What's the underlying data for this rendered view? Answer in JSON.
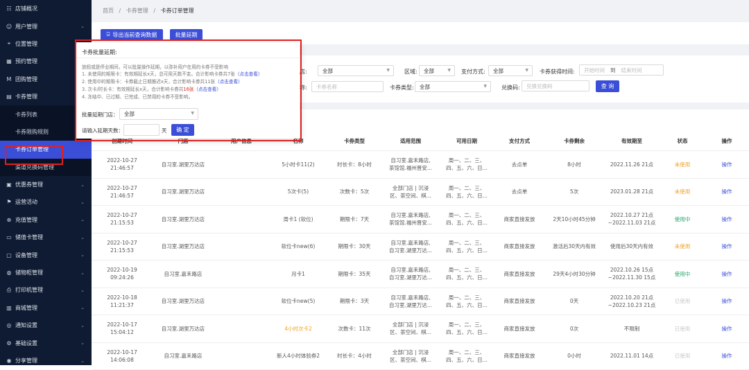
{
  "sidebar": {
    "items": [
      {
        "label": "店铺概况",
        "icon": "grid-icon",
        "glyph": "☷",
        "chev": false
      },
      {
        "label": "用户管理",
        "icon": "user-icon",
        "glyph": "☺",
        "chev": true
      },
      {
        "label": "位置管理",
        "icon": "location-icon",
        "glyph": "⌖",
        "chev": true
      },
      {
        "label": "预约管理",
        "icon": "calendar-icon",
        "glyph": "▦",
        "chev": true
      },
      {
        "label": "团购管理",
        "icon": "group-buy-icon",
        "glyph": "M",
        "chev": true
      },
      {
        "label": "卡券管理",
        "icon": "card-icon",
        "glyph": "▤",
        "chev": true,
        "open": true
      },
      {
        "label": "卡券列表",
        "sub": true
      },
      {
        "label": "卡券限购规则",
        "sub": true
      },
      {
        "label": "卡券订单管理",
        "sub": true,
        "active": true
      },
      {
        "label": "渠道兑换码管理",
        "sub": true
      },
      {
        "label": "优惠券管理",
        "icon": "coupon-icon",
        "glyph": "▣",
        "chev": true
      },
      {
        "label": "运营活动",
        "icon": "activity-icon",
        "glyph": "⚑",
        "chev": true
      },
      {
        "label": "充值管理",
        "icon": "recharge-icon",
        "glyph": "⊕",
        "chev": true
      },
      {
        "label": "储值卡管理",
        "icon": "stored-card-icon",
        "glyph": "▭",
        "chev": true
      },
      {
        "label": "设备管理",
        "icon": "device-icon",
        "glyph": "▢",
        "chev": true
      },
      {
        "label": "储物柜管理",
        "icon": "locker-icon",
        "glyph": "◍",
        "chev": true
      },
      {
        "label": "打印机管理",
        "icon": "printer-icon",
        "glyph": "⎙",
        "chev": true
      },
      {
        "label": "商城管理",
        "icon": "shop-icon",
        "glyph": "▥",
        "chev": true
      },
      {
        "label": "通知设置",
        "icon": "bell-icon",
        "glyph": "◎",
        "chev": true
      },
      {
        "label": "基础设置",
        "icon": "gear-icon",
        "glyph": "⚙",
        "chev": true
      },
      {
        "label": "分享管理",
        "icon": "share-icon",
        "glyph": "◉",
        "chev": true
      }
    ]
  },
  "breadcrumb": {
    "home": "首页",
    "sep": "/",
    "level1": "卡券管理",
    "current": "卡券订单管理"
  },
  "toolbar": {
    "export_icon": "export-icon",
    "export_glyph": "⍈",
    "export_label": "导出当前查询数据",
    "batch_label": "批量延期"
  },
  "filters": {
    "store_label": "门店:",
    "store_value": "全部",
    "region_label": "区域:",
    "region_value": "全部",
    "pay_label": "支付方式:",
    "pay_value": "全部",
    "time_label": "卡券获得时间:",
    "start_placeholder": "开始时间",
    "to": "到",
    "end_placeholder": "结束时间",
    "name_label": "名称:",
    "name_placeholder": "卡券名称",
    "type_label": "卡券类型:",
    "type_value": "全部",
    "code_label": "兑换码:",
    "code_placeholder": "兑换兑换码",
    "query_label": "查 询"
  },
  "table": {
    "columns": [
      "创建时间",
      "门店",
      "用户信息",
      "名称",
      "卡券类型",
      "适用范围",
      "可用日期",
      "支付方式",
      "卡券剩余",
      "有效期至",
      "状态",
      "操作"
    ],
    "rows": [
      {
        "time": [
          "2022-10-27",
          "21:46:57"
        ],
        "store": "自习室.湖里万达店",
        "user": "",
        "name": "5小时卡11(2)",
        "type": "时长卡：8小时",
        "scope": [
          "自习室.嘉禾路店,",
          "茶馆馆.福州晋安..."
        ],
        "date": [
          "周一、二、三、",
          "四、五、六、日..."
        ],
        "pay": "去点单",
        "remain": "8小时",
        "expire": [
          "2022.11.26 21点"
        ],
        "status": "未使用",
        "status_class": "st-unused",
        "op": "操作"
      },
      {
        "time": [
          "2022-10-27",
          "21:46:57"
        ],
        "store": "自习室.湖里万达店",
        "user": "",
        "name": "5次卡(5)",
        "type": "次数卡：5次",
        "scope": [
          "全部门店 | 沉浸",
          "区、茶空间、棋..."
        ],
        "date": [
          "周一、二、三、",
          "四、五、六、日..."
        ],
        "pay": "去点单",
        "remain": "5次",
        "expire": [
          "2023.01.28 21点"
        ],
        "status": "未使用",
        "status_class": "st-unused",
        "op": "操作"
      },
      {
        "time": [
          "2022-10-27",
          "21:15:53"
        ],
        "store": "自习室.湖里万达店",
        "user": "",
        "name": "周卡1 (软位)",
        "type": "期限卡：7天",
        "scope": [
          "自习室.嘉禾路店,",
          "茶馆馆.福州晋安..."
        ],
        "date": [
          "周一、二、三、",
          "四、五、六、日..."
        ],
        "pay": "商家直接发放",
        "remain": "2天10小时45分钟",
        "expire": [
          "2022.10.27 21点",
          "~2022.11.03 21点"
        ],
        "status": "使用中",
        "status_class": "st-using",
        "op": "操作"
      },
      {
        "time": [
          "2022-10-27",
          "21:15:53"
        ],
        "store": "自习室.湖里万达店",
        "user": "",
        "name": "软位卡new(6)",
        "type": "期限卡：30天",
        "scope": [
          "自习室.嘉禾路店,",
          "自习室.湖里万达..."
        ],
        "date": [
          "周一、二、三、",
          "四、五、六、日..."
        ],
        "pay": "商家直接发放",
        "remain": "激活后30天内有效",
        "expire": [
          "使用后30天内有效"
        ],
        "status": "未使用",
        "status_class": "st-unused",
        "op": "操作"
      },
      {
        "time": [
          "2022-10-19",
          "09:24:26"
        ],
        "store": "自习室.嘉禾路店",
        "user": "",
        "name": "月卡1",
        "type": "期限卡：35天",
        "scope": [
          "自习室.嘉禾路店,",
          "自习室.湖里万达..."
        ],
        "date": [
          "周一、二、三、",
          "四、五、六、日..."
        ],
        "pay": "商家直接发放",
        "remain": "29天4小时30分钟",
        "expire": [
          "2022.10.26 15点",
          "~2022.11.30 15点"
        ],
        "status": "使用中",
        "status_class": "st-using",
        "op": "操作"
      },
      {
        "time": [
          "2022-10-18",
          "11:21:37"
        ],
        "store": "自习室.湖里万达店",
        "user": "",
        "name": "软位卡new(5)",
        "type": "期限卡：3天",
        "scope": [
          "自习室.嘉禾路店,",
          "自习室.湖里万达..."
        ],
        "date": [
          "周一、二、三、",
          "四、五、六、日..."
        ],
        "pay": "商家直接发放",
        "remain": "0天",
        "expire": [
          "2022.10.20 21点",
          "~2022.10.23 21点"
        ],
        "status": "已使用",
        "status_class": "st-used",
        "op": "操作"
      },
      {
        "time": [
          "2022-10-17",
          "15:04:12"
        ],
        "store": "自习室.湖里万达店",
        "user": "",
        "name": "4小时次卡2",
        "type": "次数卡：11次",
        "scope": [
          "全部门店 | 沉浸",
          "区、茶空间、棋..."
        ],
        "date": [
          "周一、二、三、",
          "四、五、六、日..."
        ],
        "pay": "商家直接发放",
        "remain": "0次",
        "expire": [
          "不限制"
        ],
        "status": "已使用",
        "status_class": "st-used",
        "op": "操作"
      },
      {
        "time": [
          "2022-10-17",
          "14:06:08"
        ],
        "store": "自习室.嘉禾路店",
        "user": "",
        "name": "新人4小时体验券2",
        "type": "时长卡：4小时",
        "scope": [
          "全部门店 | 沉浸",
          "区、茶空间、棋..."
        ],
        "date": [
          "周一、二、三、",
          "四、五、六、日..."
        ],
        "pay": "商家直接发放",
        "remain": "0小时",
        "expire": [
          "2022.11.01 14点"
        ],
        "status": "已使用",
        "status_class": "st-used",
        "op": "操作"
      }
    ]
  },
  "popup": {
    "title": "卡券批量延期:",
    "intro": "放假或是停业期间，可以批量操作延期，以弥补用户在用的卡券不受影响",
    "line1_pre": "1. 未使用的期限卡：有效期延长x天，总可用天数不变。合计影响卡券共7张",
    "line1_link": "（点击查看）",
    "line2_pre": "2. 使用中的期限卡：卡券截止日期推迟x天，合计影响卡券共11张",
    "line2_link": "（点击查看）",
    "line3_pre": "3. 次卡/时长卡：有效期延长x天，合计影响卡券共",
    "line3_count": "16张",
    "line3_link": "（点击查看）",
    "line4": "4. 冻结中、已过期、已完成、已禁用的卡券不受影响。",
    "store_label": "批量延期门店：",
    "store_value": "全部",
    "days_label": "请输入延期天数：",
    "days_value": "",
    "days_unit": "天",
    "confirm_label": "确 定"
  }
}
